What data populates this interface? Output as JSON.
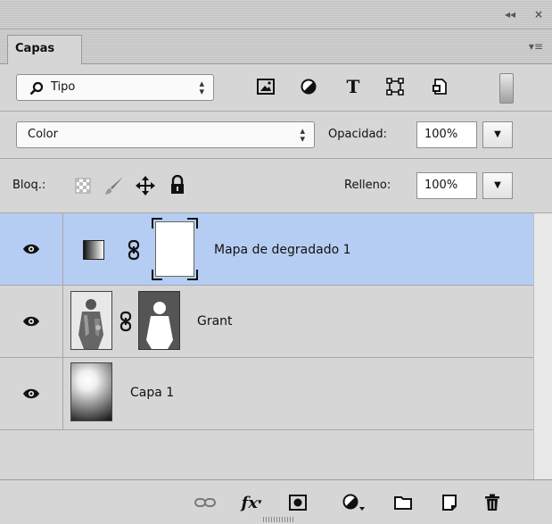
{
  "panel": {
    "tab_label": "Capas",
    "collapse_glyph": "◂◂",
    "close_glyph": "×",
    "menu_glyph": "▾≡"
  },
  "filter": {
    "kind_label": "Tipo",
    "icons": [
      "image-filter-icon",
      "adjustment-filter-icon",
      "type-filter-icon",
      "shape-filter-icon",
      "smart-object-filter-icon"
    ],
    "type_glyph": "T"
  },
  "blend": {
    "mode": "Color",
    "opacity_label": "Opacidad:",
    "opacity_value": "100%"
  },
  "lock": {
    "label": "Bloq.:",
    "fill_label": "Relleno:",
    "fill_value": "100%"
  },
  "layers": [
    {
      "name": "Mapa de degradado 1",
      "selected": true,
      "kind": "adjustment"
    },
    {
      "name": "Grant",
      "selected": false,
      "kind": "masked-image"
    },
    {
      "name": "Capa 1",
      "selected": false,
      "kind": "gradient"
    }
  ],
  "colors": {
    "selection": "#b6cdf3",
    "panel_bg": "#d6d6d6"
  }
}
